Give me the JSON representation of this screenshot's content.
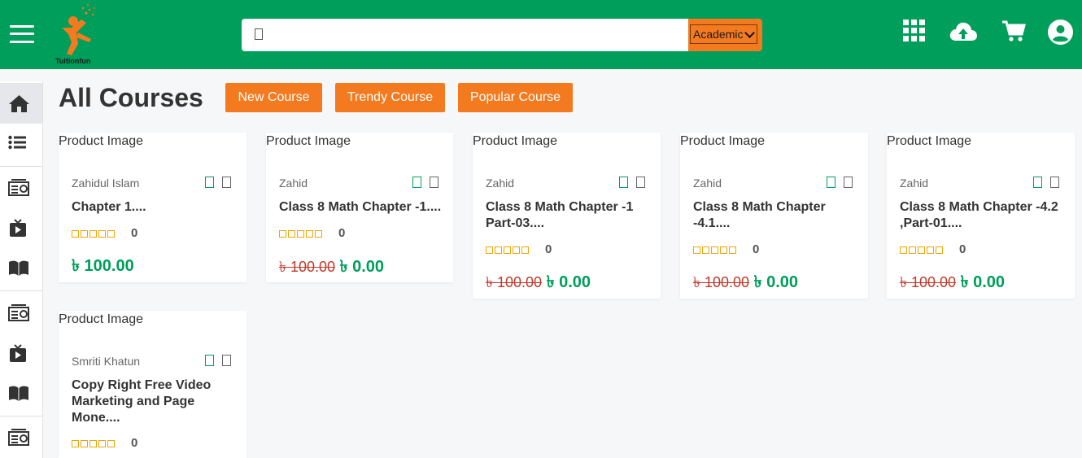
{
  "header": {
    "logo_text": "Tuitionfun",
    "search": {
      "value": "",
      "placeholder": ""
    },
    "category_select": {
      "selected": "Academic"
    },
    "colors": {
      "brand_green": "#009e5b",
      "accent_orange": "#f47a20"
    },
    "icons": [
      "grid-icon",
      "cloud-upload-icon",
      "cart-icon",
      "user-icon"
    ]
  },
  "sidebar": {
    "items": [
      {
        "icon": "home-icon"
      },
      {
        "icon": "list-icon"
      },
      {
        "icon": "radio-icon"
      },
      {
        "icon": "video-icon"
      },
      {
        "icon": "book-icon"
      },
      {
        "icon": "radio-icon"
      },
      {
        "icon": "video-icon"
      },
      {
        "icon": "book-icon"
      },
      {
        "icon": "radio-icon"
      }
    ]
  },
  "main": {
    "title": "All Courses",
    "filters": [
      {
        "label": "New Course"
      },
      {
        "label": "Trendy Course"
      },
      {
        "label": "Popular Course"
      }
    ],
    "currency": "৳",
    "courses": [
      {
        "image_alt": "Product Image",
        "author": "Zahidul Islam",
        "title": "Chapter 1....",
        "rating_count": "0",
        "old_price": "",
        "price": "৳ 100.00"
      },
      {
        "image_alt": "Product Image",
        "author": "Zahid",
        "title": "Class 8 Math Chapter -1....",
        "rating_count": "0",
        "old_price": "৳ 100.00",
        "price": "৳ 0.00"
      },
      {
        "image_alt": "Product Image",
        "author": "Zahid",
        "title": "Class 8 Math Chapter -1 Part-03....",
        "rating_count": "0",
        "old_price": "৳ 100.00",
        "price": "৳ 0.00"
      },
      {
        "image_alt": "Product Image",
        "author": "Zahid",
        "title": "Class 8 Math Chapter -4.1....",
        "rating_count": "0",
        "old_price": "৳ 100.00",
        "price": "৳ 0.00"
      },
      {
        "image_alt": "Product Image",
        "author": "Zahid",
        "title": "Class 8 Math Chapter -4.2 ,Part-01....",
        "rating_count": "0",
        "old_price": "৳ 100.00",
        "price": "৳ 0.00"
      },
      {
        "image_alt": "Product Image",
        "author": "Smriti Khatun",
        "title": "Copy Right Free Video Marketing and Page Mone....",
        "rating_count": "0",
        "old_price": "",
        "price": ""
      }
    ]
  }
}
